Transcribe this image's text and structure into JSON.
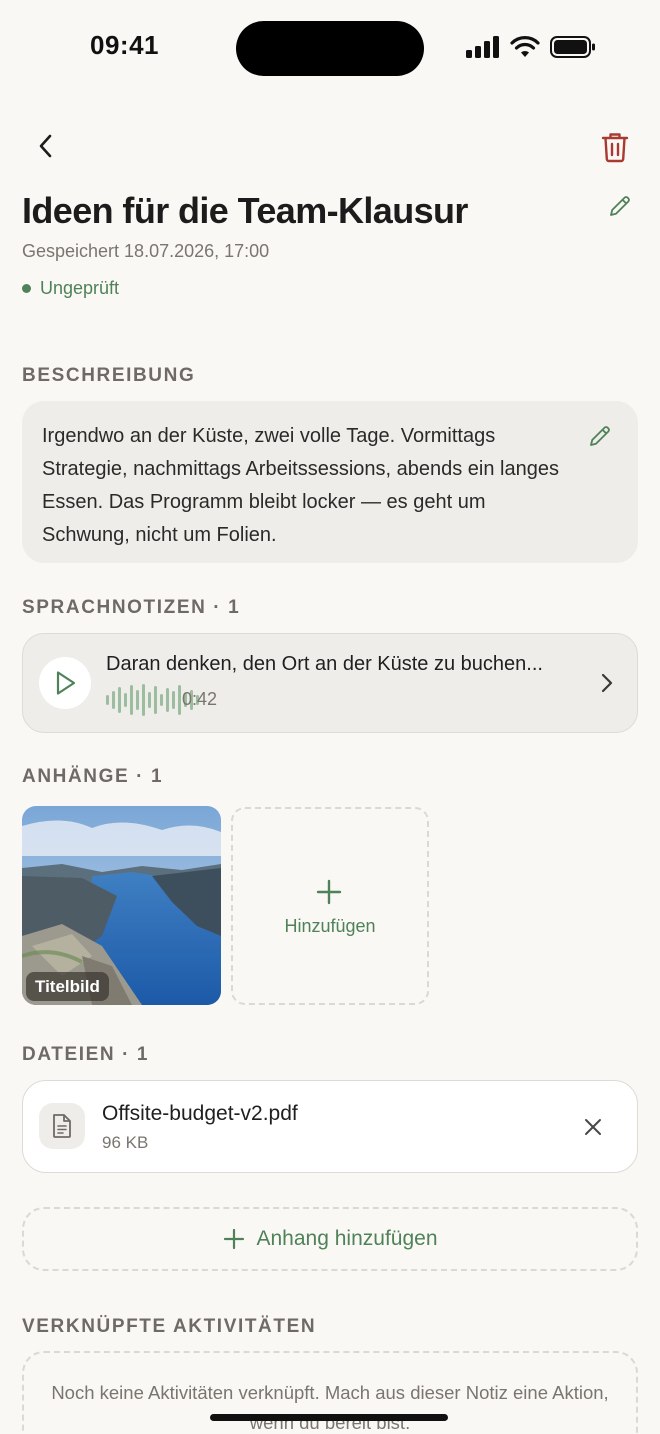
{
  "status_bar": {
    "time": "09:41"
  },
  "note": {
    "title": "Ideen für die Team-Klausur",
    "saved": "Gespeichert 18.07.2026, 17:00",
    "status": "Ungeprüft"
  },
  "description": {
    "label": "BESCHREIBUNG",
    "text": "Irgendwo an der Küste, zwei volle Tage. Vormittags Strategie, nachmittags Arbeitssessions, abends ein langes Essen. Das Programm bleibt locker — es geht um Schwung, nicht um Folien."
  },
  "voice_notes": {
    "label": "SPRACHNOTIZEN · 1",
    "items": [
      {
        "title": "Daran denken, den Ort an der Küste zu buchen...",
        "duration": "0:42"
      }
    ]
  },
  "attachments": {
    "label": "ANHÄNGE · 1",
    "cover_badge": "Titelbild",
    "add_label": "Hinzufügen"
  },
  "files": {
    "label": "DATEIEN · 1",
    "items": [
      {
        "name": "Offsite-budget-v2.pdf",
        "size": "96 KB"
      }
    ]
  },
  "add_attachment_label": "Anhang hinzufügen",
  "linked_activities": {
    "label": "VERKNÜPFTE AKTIVITÄTEN",
    "empty_text": "Noch keine Aktivitäten verknüpft. Mach aus dieser Notiz eine Aktion, wenn du bereit bist."
  },
  "colors": {
    "accent": "#4f8258",
    "danger": "#a83a32",
    "background": "#faf8f5",
    "card": "#efedea"
  },
  "icons": [
    "back-icon",
    "trash-icon",
    "pencil-icon",
    "play-icon",
    "chevron-right-icon",
    "plus-icon",
    "document-icon",
    "close-icon"
  ]
}
